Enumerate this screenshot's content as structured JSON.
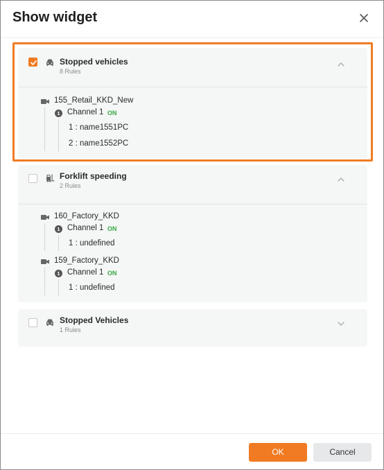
{
  "dialog": {
    "title": "Show widget"
  },
  "cards": [
    {
      "title": "Stopped vehicles",
      "subtitle": "8 Rules",
      "checked": true,
      "expanded": true,
      "cameras": [
        {
          "name": "155_Retail_KKD_New",
          "channel_num": "1",
          "channel_label": "Channel 1",
          "status": "ON",
          "rules": [
            "1 : name1551PC",
            "2 : name1552PC"
          ]
        }
      ]
    },
    {
      "title": "Forklift speeding",
      "subtitle": "2 Rules",
      "checked": false,
      "expanded": true,
      "cameras": [
        {
          "name": "160_Factory_KKD",
          "channel_num": "1",
          "channel_label": "Channel 1",
          "status": "ON",
          "rules": [
            "1 : undefined"
          ]
        },
        {
          "name": "159_Factory_KKD",
          "channel_num": "1",
          "channel_label": "Channel 1",
          "status": "ON",
          "rules": [
            "1 : undefined"
          ]
        }
      ]
    },
    {
      "title": "Stopped Vehicles",
      "subtitle": "1 Rules",
      "checked": false,
      "expanded": false,
      "cameras": []
    }
  ],
  "footer": {
    "ok_label": "OK",
    "cancel_label": "Cancel"
  },
  "colors": {
    "accent": "#f07b22",
    "status_on": "#3aa845"
  },
  "icons": {
    "close": "close-icon",
    "vehicle": "car-icon",
    "forklift": "forklift-icon",
    "camera": "camera-icon",
    "chevron_up": "chevron-up-icon",
    "chevron_down": "chevron-down-icon",
    "check": "checkmark-icon"
  }
}
